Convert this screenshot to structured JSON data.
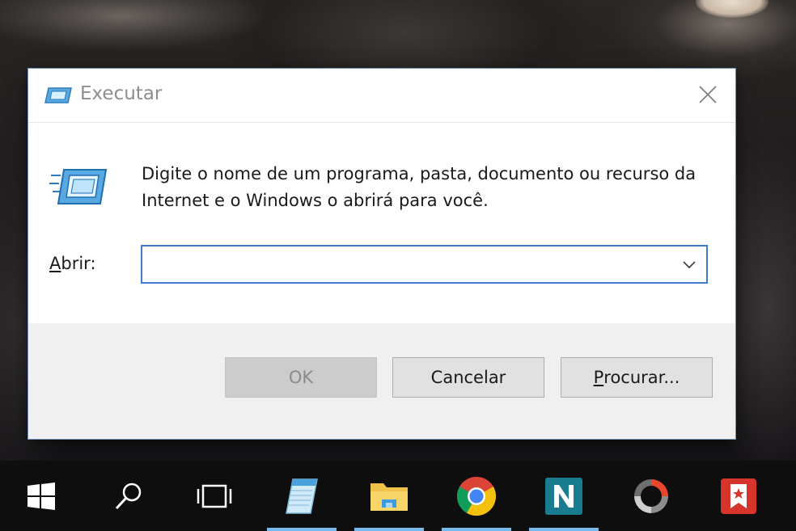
{
  "dialog": {
    "title": "Executar",
    "description": "Digite o nome de um programa, pasta, documento ou recurso da Internet e o Windows o abrirá para você.",
    "open_label_accesskey": "A",
    "open_label_rest": "brir:",
    "open_input_value": "",
    "buttons": {
      "ok": "OK",
      "cancel": "Cancelar",
      "browse_accesskey": "P",
      "browse_rest": "rocurar..."
    }
  },
  "taskbar": {
    "items": [
      {
        "name": "start",
        "icon": "windows-logo-icon"
      },
      {
        "name": "search",
        "icon": "search-icon"
      },
      {
        "name": "task-view",
        "icon": "task-view-icon"
      },
      {
        "name": "notepad",
        "icon": "notepad-icon",
        "active": true
      },
      {
        "name": "file-explorer",
        "icon": "folder-icon",
        "active": true
      },
      {
        "name": "chrome",
        "icon": "chrome-icon",
        "active": true
      },
      {
        "name": "app-n",
        "icon": "n-app-icon",
        "active": true
      },
      {
        "name": "app-circle",
        "icon": "circle-app-icon"
      },
      {
        "name": "app-bookmark",
        "icon": "bookmark-app-icon"
      }
    ]
  },
  "colors": {
    "accent": "#3d7ccf",
    "taskbar": "#0e0e0f",
    "active_indicator": "#76b9ed"
  }
}
